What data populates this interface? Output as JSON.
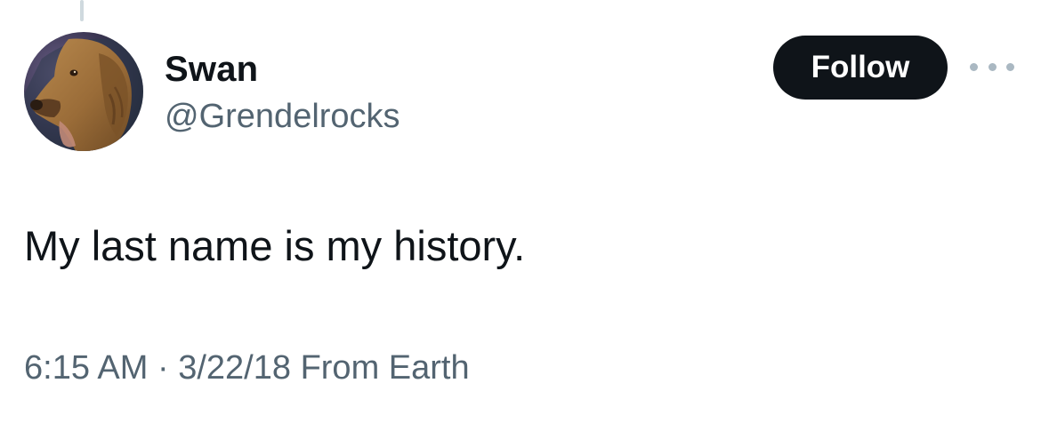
{
  "tweet": {
    "author": {
      "display_name": "Swan",
      "handle": "@Grendelrocks",
      "avatar_icon": "dog-avatar-icon"
    },
    "follow_label": "Follow",
    "more_icon": "more-options-icon",
    "text": "My last name is my history.",
    "meta": {
      "time": "6:15 AM",
      "separator": "·",
      "date": "3/22/18",
      "source": "From Earth"
    }
  },
  "colors": {
    "text_primary": "#0f1419",
    "text_secondary": "#536471",
    "follow_bg": "#0f1419",
    "follow_text": "#ffffff",
    "thread_line": "#cfd9de"
  }
}
